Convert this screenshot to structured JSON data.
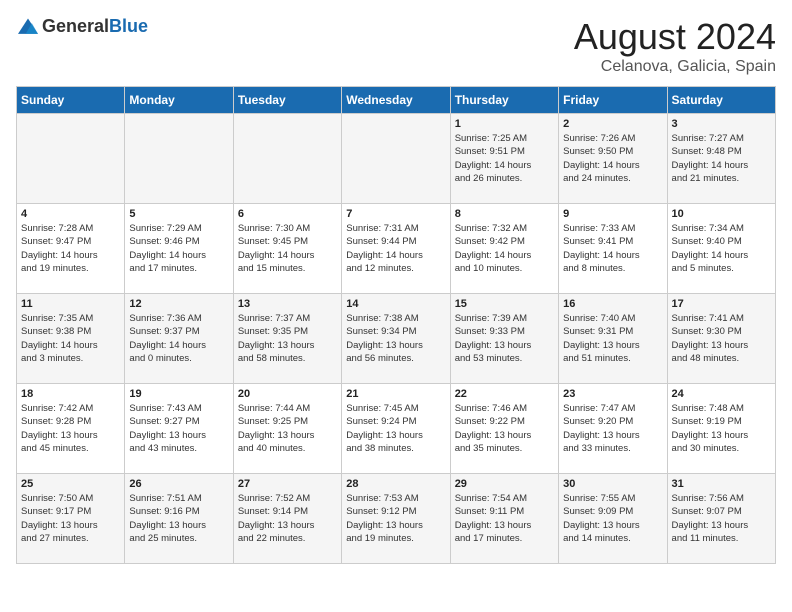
{
  "header": {
    "logo_general": "General",
    "logo_blue": "Blue",
    "month_year": "August 2024",
    "location": "Celanova, Galicia, Spain"
  },
  "weekdays": [
    "Sunday",
    "Monday",
    "Tuesday",
    "Wednesday",
    "Thursday",
    "Friday",
    "Saturday"
  ],
  "weeks": [
    [
      {
        "day": "",
        "info": ""
      },
      {
        "day": "",
        "info": ""
      },
      {
        "day": "",
        "info": ""
      },
      {
        "day": "",
        "info": ""
      },
      {
        "day": "1",
        "info": "Sunrise: 7:25 AM\nSunset: 9:51 PM\nDaylight: 14 hours\nand 26 minutes."
      },
      {
        "day": "2",
        "info": "Sunrise: 7:26 AM\nSunset: 9:50 PM\nDaylight: 14 hours\nand 24 minutes."
      },
      {
        "day": "3",
        "info": "Sunrise: 7:27 AM\nSunset: 9:48 PM\nDaylight: 14 hours\nand 21 minutes."
      }
    ],
    [
      {
        "day": "4",
        "info": "Sunrise: 7:28 AM\nSunset: 9:47 PM\nDaylight: 14 hours\nand 19 minutes."
      },
      {
        "day": "5",
        "info": "Sunrise: 7:29 AM\nSunset: 9:46 PM\nDaylight: 14 hours\nand 17 minutes."
      },
      {
        "day": "6",
        "info": "Sunrise: 7:30 AM\nSunset: 9:45 PM\nDaylight: 14 hours\nand 15 minutes."
      },
      {
        "day": "7",
        "info": "Sunrise: 7:31 AM\nSunset: 9:44 PM\nDaylight: 14 hours\nand 12 minutes."
      },
      {
        "day": "8",
        "info": "Sunrise: 7:32 AM\nSunset: 9:42 PM\nDaylight: 14 hours\nand 10 minutes."
      },
      {
        "day": "9",
        "info": "Sunrise: 7:33 AM\nSunset: 9:41 PM\nDaylight: 14 hours\nand 8 minutes."
      },
      {
        "day": "10",
        "info": "Sunrise: 7:34 AM\nSunset: 9:40 PM\nDaylight: 14 hours\nand 5 minutes."
      }
    ],
    [
      {
        "day": "11",
        "info": "Sunrise: 7:35 AM\nSunset: 9:38 PM\nDaylight: 14 hours\nand 3 minutes."
      },
      {
        "day": "12",
        "info": "Sunrise: 7:36 AM\nSunset: 9:37 PM\nDaylight: 14 hours\nand 0 minutes."
      },
      {
        "day": "13",
        "info": "Sunrise: 7:37 AM\nSunset: 9:35 PM\nDaylight: 13 hours\nand 58 minutes."
      },
      {
        "day": "14",
        "info": "Sunrise: 7:38 AM\nSunset: 9:34 PM\nDaylight: 13 hours\nand 56 minutes."
      },
      {
        "day": "15",
        "info": "Sunrise: 7:39 AM\nSunset: 9:33 PM\nDaylight: 13 hours\nand 53 minutes."
      },
      {
        "day": "16",
        "info": "Sunrise: 7:40 AM\nSunset: 9:31 PM\nDaylight: 13 hours\nand 51 minutes."
      },
      {
        "day": "17",
        "info": "Sunrise: 7:41 AM\nSunset: 9:30 PM\nDaylight: 13 hours\nand 48 minutes."
      }
    ],
    [
      {
        "day": "18",
        "info": "Sunrise: 7:42 AM\nSunset: 9:28 PM\nDaylight: 13 hours\nand 45 minutes."
      },
      {
        "day": "19",
        "info": "Sunrise: 7:43 AM\nSunset: 9:27 PM\nDaylight: 13 hours\nand 43 minutes."
      },
      {
        "day": "20",
        "info": "Sunrise: 7:44 AM\nSunset: 9:25 PM\nDaylight: 13 hours\nand 40 minutes."
      },
      {
        "day": "21",
        "info": "Sunrise: 7:45 AM\nSunset: 9:24 PM\nDaylight: 13 hours\nand 38 minutes."
      },
      {
        "day": "22",
        "info": "Sunrise: 7:46 AM\nSunset: 9:22 PM\nDaylight: 13 hours\nand 35 minutes."
      },
      {
        "day": "23",
        "info": "Sunrise: 7:47 AM\nSunset: 9:20 PM\nDaylight: 13 hours\nand 33 minutes."
      },
      {
        "day": "24",
        "info": "Sunrise: 7:48 AM\nSunset: 9:19 PM\nDaylight: 13 hours\nand 30 minutes."
      }
    ],
    [
      {
        "day": "25",
        "info": "Sunrise: 7:50 AM\nSunset: 9:17 PM\nDaylight: 13 hours\nand 27 minutes."
      },
      {
        "day": "26",
        "info": "Sunrise: 7:51 AM\nSunset: 9:16 PM\nDaylight: 13 hours\nand 25 minutes."
      },
      {
        "day": "27",
        "info": "Sunrise: 7:52 AM\nSunset: 9:14 PM\nDaylight: 13 hours\nand 22 minutes."
      },
      {
        "day": "28",
        "info": "Sunrise: 7:53 AM\nSunset: 9:12 PM\nDaylight: 13 hours\nand 19 minutes."
      },
      {
        "day": "29",
        "info": "Sunrise: 7:54 AM\nSunset: 9:11 PM\nDaylight: 13 hours\nand 17 minutes."
      },
      {
        "day": "30",
        "info": "Sunrise: 7:55 AM\nSunset: 9:09 PM\nDaylight: 13 hours\nand 14 minutes."
      },
      {
        "day": "31",
        "info": "Sunrise: 7:56 AM\nSunset: 9:07 PM\nDaylight: 13 hours\nand 11 minutes."
      }
    ]
  ]
}
